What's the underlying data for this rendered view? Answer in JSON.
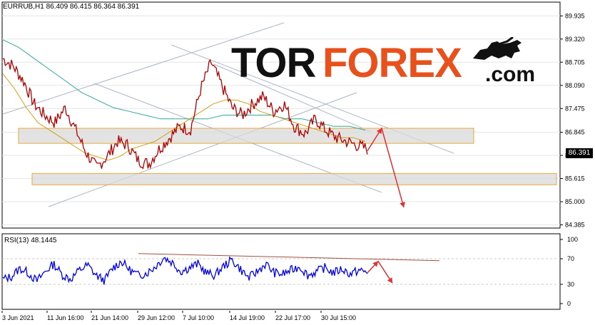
{
  "header": {
    "symbol_line": "EURRUB,H1  86.409 86.415 86.364 86.391",
    "rsi_line": "RSI(13) 48.1445"
  },
  "logo": {
    "tor": "TOR",
    "forex": "FOREX",
    "com": ".com"
  },
  "current_price": "86.391",
  "colors": {
    "price_line": "#b00000",
    "ma_fast": "#d4a017",
    "ma_slow": "#2ea89a",
    "channel": "#aab6c4",
    "zone_fill": "#d9d9d9",
    "zone_border": "#e8a93a",
    "arrow": "#e03030",
    "rsi_line": "#0000ee",
    "rsi_trend": "#a05040",
    "brand_orange": "#e8501c"
  },
  "chart_data": [
    {
      "type": "line",
      "title": "EURRUB,H1",
      "ylim": [
        84.3,
        90.3
      ],
      "yticks": [
        "89.935",
        "89.320",
        "88.705",
        "88.090",
        "87.475",
        "86.845",
        "86.230",
        "85.615",
        "85.000",
        "84.385"
      ],
      "x": [
        "3 Jun 2021",
        "11 Jun 16:00",
        "21 Jun 14:00",
        "29 Jun 12:00",
        "7 Jul 10:00",
        "14 Jul 19:00",
        "22 Jul 17:00",
        "30 Jul 15:00"
      ],
      "series": [
        {
          "values": [
            88.8,
            88.6,
            88.2,
            87.6,
            87.3,
            87.1,
            87.5,
            86.9,
            86.3,
            85.9,
            86.2,
            86.6,
            86.5,
            86.1,
            86.0,
            86.4,
            86.7,
            87.0,
            86.9,
            88.0,
            88.7,
            88.1,
            87.5,
            87.3,
            87.6,
            87.8,
            87.4,
            87.6,
            87.0,
            86.8,
            87.2,
            86.9,
            86.7,
            86.6,
            86.5,
            86.4
          ]
        },
        {
          "values": [
            88.4,
            88.0,
            87.5,
            87.1,
            86.9,
            86.7,
            86.5,
            86.3,
            86.2,
            86.1,
            86.2,
            86.4,
            86.5,
            86.6,
            86.8,
            87.0,
            87.2,
            87.4,
            87.6,
            87.7,
            87.7,
            87.6,
            87.4,
            87.3,
            87.2,
            87.1,
            87.0,
            86.9,
            86.8,
            86.7,
            86.7,
            86.6
          ]
        },
        {
          "values": [
            89.3,
            89.1,
            88.8,
            88.5,
            88.2,
            87.9,
            87.7,
            87.5,
            87.4,
            87.3,
            87.2,
            87.2,
            87.2,
            87.2,
            87.3,
            87.3,
            87.3,
            87.3,
            87.2,
            87.2,
            87.1,
            87.0,
            87.0,
            86.9
          ]
        }
      ],
      "zones": [
        {
          "from": 86.55,
          "to": 86.95
        },
        {
          "from": 85.45,
          "to": 85.75
        }
      ],
      "forecast_path": [
        86.35,
        86.95,
        84.85
      ]
    },
    {
      "type": "line",
      "title": "RSI(13) 48.1445",
      "ylim": [
        0,
        100
      ],
      "yticks": [
        "100",
        "70",
        "30",
        "0"
      ],
      "series": [
        {
          "values": [
            38,
            42,
            55,
            48,
            35,
            50,
            62,
            45,
            38,
            52,
            60,
            44,
            36,
            56,
            66,
            52,
            44,
            48,
            58,
            72,
            64,
            50,
            56,
            62,
            48,
            44,
            58,
            68,
            54,
            40,
            50,
            62,
            48,
            46,
            52,
            58,
            44,
            50,
            56,
            48,
            54,
            46,
            52,
            48
          ]
        }
      ],
      "forecast_path": [
        48,
        66,
        32
      ]
    }
  ]
}
